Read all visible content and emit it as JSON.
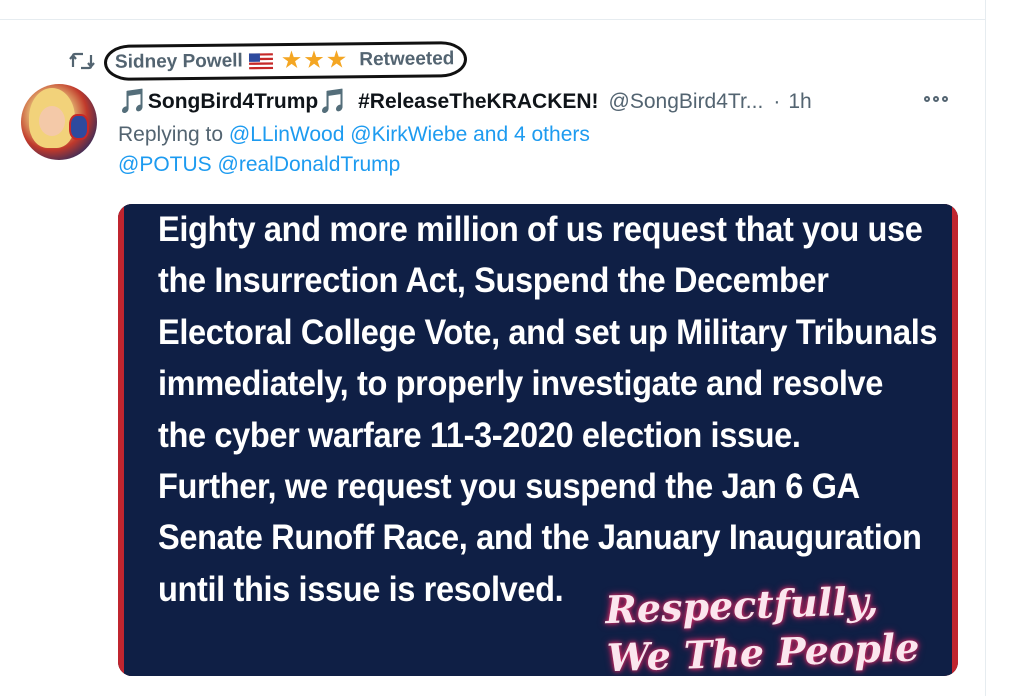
{
  "retweet": {
    "name": "Sidney Powell",
    "flag": "🇺🇸",
    "stars": [
      "★",
      "★",
      "★"
    ],
    "label": "Retweeted"
  },
  "tweet": {
    "note_left": "🎵",
    "display_name": "SongBird4Trump",
    "note_right": "🎵",
    "hashtag": "#ReleaseTheKRACKEN!",
    "handle": "@SongBird4Tr...",
    "dot": "·",
    "time": "1h",
    "reply_prefix": "Replying to",
    "reply_mention_1": "@LLinWood",
    "reply_mention_2": "@KirkWiebe",
    "reply_others": "and 4 others",
    "mention_potus": "@POTUS",
    "mention_trump": "@realDonaldTrump"
  },
  "media": {
    "lines": [
      "Eighty and more million of us request that you use",
      "the Insurrection Act, Suspend the December",
      "Electoral College Vote, and set up Military Tribunals",
      "immediately, to properly investigate and resolve",
      "the cyber warfare 11-3-2020 election issue.",
      "Further, we request you suspend the Jan 6 GA",
      "Senate Runoff Race, and the January Inauguration",
      "until this issue is resolved."
    ],
    "signoff_1": "Respectfully,",
    "signoff_2": "We The People"
  },
  "colors": {
    "accent": "#1d9bf0",
    "muted": "#536471",
    "media_bg": "#0f1f45",
    "media_border": "#c0252f",
    "star": "#f4a623"
  },
  "icons": {
    "retweet": "retweet-icon",
    "more": "more-icon",
    "flag": "us-flag-icon"
  }
}
